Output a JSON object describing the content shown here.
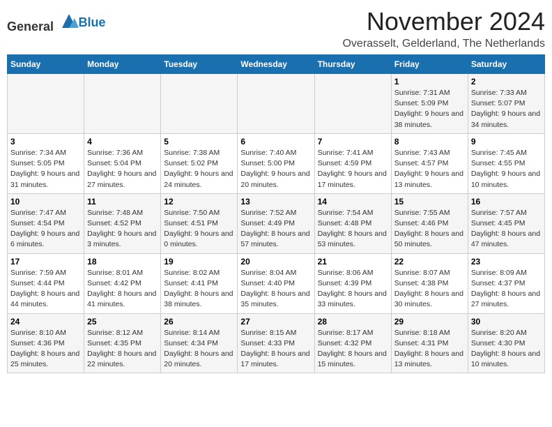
{
  "header": {
    "logo_general": "General",
    "logo_blue": "Blue",
    "month_title": "November 2024",
    "location": "Overasselt, Gelderland, The Netherlands"
  },
  "weekdays": [
    "Sunday",
    "Monday",
    "Tuesday",
    "Wednesday",
    "Thursday",
    "Friday",
    "Saturday"
  ],
  "weeks": [
    [
      {
        "day": "",
        "info": ""
      },
      {
        "day": "",
        "info": ""
      },
      {
        "day": "",
        "info": ""
      },
      {
        "day": "",
        "info": ""
      },
      {
        "day": "",
        "info": ""
      },
      {
        "day": "1",
        "info": "Sunrise: 7:31 AM\nSunset: 5:09 PM\nDaylight: 9 hours and 38 minutes."
      },
      {
        "day": "2",
        "info": "Sunrise: 7:33 AM\nSunset: 5:07 PM\nDaylight: 9 hours and 34 minutes."
      }
    ],
    [
      {
        "day": "3",
        "info": "Sunrise: 7:34 AM\nSunset: 5:05 PM\nDaylight: 9 hours and 31 minutes."
      },
      {
        "day": "4",
        "info": "Sunrise: 7:36 AM\nSunset: 5:04 PM\nDaylight: 9 hours and 27 minutes."
      },
      {
        "day": "5",
        "info": "Sunrise: 7:38 AM\nSunset: 5:02 PM\nDaylight: 9 hours and 24 minutes."
      },
      {
        "day": "6",
        "info": "Sunrise: 7:40 AM\nSunset: 5:00 PM\nDaylight: 9 hours and 20 minutes."
      },
      {
        "day": "7",
        "info": "Sunrise: 7:41 AM\nSunset: 4:59 PM\nDaylight: 9 hours and 17 minutes."
      },
      {
        "day": "8",
        "info": "Sunrise: 7:43 AM\nSunset: 4:57 PM\nDaylight: 9 hours and 13 minutes."
      },
      {
        "day": "9",
        "info": "Sunrise: 7:45 AM\nSunset: 4:55 PM\nDaylight: 9 hours and 10 minutes."
      }
    ],
    [
      {
        "day": "10",
        "info": "Sunrise: 7:47 AM\nSunset: 4:54 PM\nDaylight: 9 hours and 6 minutes."
      },
      {
        "day": "11",
        "info": "Sunrise: 7:48 AM\nSunset: 4:52 PM\nDaylight: 9 hours and 3 minutes."
      },
      {
        "day": "12",
        "info": "Sunrise: 7:50 AM\nSunset: 4:51 PM\nDaylight: 9 hours and 0 minutes."
      },
      {
        "day": "13",
        "info": "Sunrise: 7:52 AM\nSunset: 4:49 PM\nDaylight: 8 hours and 57 minutes."
      },
      {
        "day": "14",
        "info": "Sunrise: 7:54 AM\nSunset: 4:48 PM\nDaylight: 8 hours and 53 minutes."
      },
      {
        "day": "15",
        "info": "Sunrise: 7:55 AM\nSunset: 4:46 PM\nDaylight: 8 hours and 50 minutes."
      },
      {
        "day": "16",
        "info": "Sunrise: 7:57 AM\nSunset: 4:45 PM\nDaylight: 8 hours and 47 minutes."
      }
    ],
    [
      {
        "day": "17",
        "info": "Sunrise: 7:59 AM\nSunset: 4:44 PM\nDaylight: 8 hours and 44 minutes."
      },
      {
        "day": "18",
        "info": "Sunrise: 8:01 AM\nSunset: 4:42 PM\nDaylight: 8 hours and 41 minutes."
      },
      {
        "day": "19",
        "info": "Sunrise: 8:02 AM\nSunset: 4:41 PM\nDaylight: 8 hours and 38 minutes."
      },
      {
        "day": "20",
        "info": "Sunrise: 8:04 AM\nSunset: 4:40 PM\nDaylight: 8 hours and 35 minutes."
      },
      {
        "day": "21",
        "info": "Sunrise: 8:06 AM\nSunset: 4:39 PM\nDaylight: 8 hours and 33 minutes."
      },
      {
        "day": "22",
        "info": "Sunrise: 8:07 AM\nSunset: 4:38 PM\nDaylight: 8 hours and 30 minutes."
      },
      {
        "day": "23",
        "info": "Sunrise: 8:09 AM\nSunset: 4:37 PM\nDaylight: 8 hours and 27 minutes."
      }
    ],
    [
      {
        "day": "24",
        "info": "Sunrise: 8:10 AM\nSunset: 4:36 PM\nDaylight: 8 hours and 25 minutes."
      },
      {
        "day": "25",
        "info": "Sunrise: 8:12 AM\nSunset: 4:35 PM\nDaylight: 8 hours and 22 minutes."
      },
      {
        "day": "26",
        "info": "Sunrise: 8:14 AM\nSunset: 4:34 PM\nDaylight: 8 hours and 20 minutes."
      },
      {
        "day": "27",
        "info": "Sunrise: 8:15 AM\nSunset: 4:33 PM\nDaylight: 8 hours and 17 minutes."
      },
      {
        "day": "28",
        "info": "Sunrise: 8:17 AM\nSunset: 4:32 PM\nDaylight: 8 hours and 15 minutes."
      },
      {
        "day": "29",
        "info": "Sunrise: 8:18 AM\nSunset: 4:31 PM\nDaylight: 8 hours and 13 minutes."
      },
      {
        "day": "30",
        "info": "Sunrise: 8:20 AM\nSunset: 4:30 PM\nDaylight: 8 hours and 10 minutes."
      }
    ]
  ]
}
